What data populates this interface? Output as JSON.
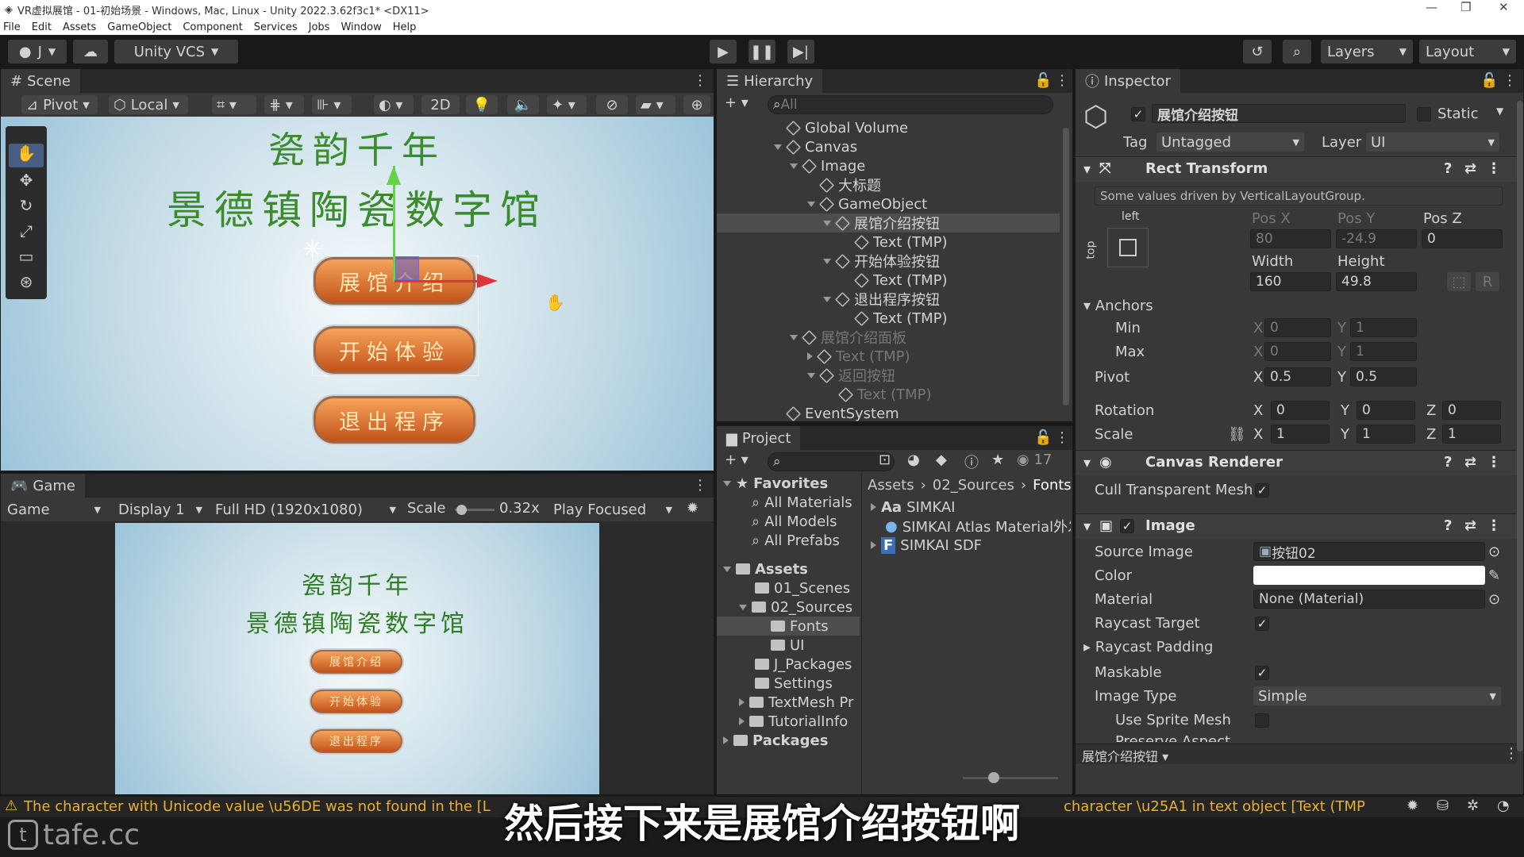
{
  "titlebar": {
    "title": "VR虚拟展馆 - 01-初始场景 - Windows, Mac, Linux - Unity 2022.3.62f3c1* <DX11>"
  },
  "menu": [
    "File",
    "Edit",
    "Assets",
    "GameObject",
    "Component",
    "Services",
    "Jobs",
    "Window",
    "Help"
  ],
  "toolbar": {
    "account": "J",
    "vcs": "Unity VCS",
    "layers": "Layers",
    "layout": "Layout"
  },
  "scene": {
    "tab": "Scene",
    "pivot": "Pivot",
    "local": "Local",
    "mode2d": "2D",
    "title1": "瓷韵千年",
    "title2": "景德镇陶瓷数字馆",
    "buttons": [
      "展馆介绍",
      "开始体验",
      "退出程序"
    ]
  },
  "game": {
    "tab": "Game",
    "mode": "Game",
    "display": "Display 1",
    "resolution": "Full HD (1920x1080)",
    "scale_label": "Scale",
    "scale_value": "0.32x",
    "play": "Play Focused",
    "title1": "瓷韵千年",
    "title2": "景德镇陶瓷数字馆",
    "buttons": [
      "展馆介绍",
      "开始体验",
      "退出程序"
    ]
  },
  "hierarchy": {
    "tab": "Hierarchy",
    "search": "All",
    "items": [
      "Global Volume",
      "Canvas",
      "Image",
      "大标题",
      "GameObject",
      "展馆介绍按钮",
      "Text (TMP)",
      "开始体验按钮",
      "Text (TMP)",
      "退出程序按钮",
      "Text (TMP)",
      "展馆介绍面板",
      "Text (TMP)",
      "返回按钮",
      "Text (TMP)",
      "EventSystem"
    ]
  },
  "project": {
    "tab": "Project",
    "count": "17",
    "tree": [
      "Favorites",
      "All Materials",
      "All Models",
      "All Prefabs",
      "Assets",
      "01_Scenes",
      "02_Sources",
      "Fonts",
      "UI",
      "J_Packages",
      "Settings",
      "TextMesh Pr",
      "TutorialInfo",
      "Packages"
    ],
    "breadcrumb": [
      "Assets",
      "02_Sources",
      "Fonts"
    ],
    "files": [
      "SIMKAI",
      "SIMKAI Atlas Material外发",
      "SIMKAI SDF"
    ],
    "file_prefix": [
      "Aa",
      "",
      "F"
    ]
  },
  "inspector": {
    "tab": "Inspector",
    "name": "展馆介绍按钮",
    "static": "Static",
    "tag_label": "Tag",
    "tag": "Untagged",
    "layer_label": "Layer",
    "layer": "UI",
    "rect": {
      "title": "Rect Transform",
      "note": "Some values driven by VerticalLayoutGroup.",
      "anchor_h": "left",
      "anchor_v": "top",
      "posx_label": "Pos X",
      "posy_label": "Pos Y",
      "posz_label": "Pos Z",
      "posx": "80",
      "posy": "-24.9",
      "posz": "0",
      "width_label": "Width",
      "height_label": "Height",
      "width": "160",
      "height": "49.8",
      "anchors": "Anchors",
      "min": "Min",
      "max": "Max",
      "min_x": "0",
      "min_y": "1",
      "max_x": "0",
      "max_y": "1",
      "pivot": "Pivot",
      "pivot_x": "0.5",
      "pivot_y": "0.5",
      "rotation": "Rotation",
      "rot": [
        "0",
        "0",
        "0"
      ],
      "scale": "Scale",
      "scl": [
        "1",
        "1",
        "1"
      ],
      "r_btn": "R"
    },
    "canvas_renderer": {
      "title": "Canvas Renderer",
      "cull": "Cull Transparent Mesh"
    },
    "image": {
      "title": "Image",
      "source_label": "Source Image",
      "source": "按钮02",
      "color_label": "Color",
      "material_label": "Material",
      "material": "None (Material)",
      "raycast": "Raycast Target",
      "padding": "Raycast Padding",
      "maskable": "Maskable",
      "type_label": "Image Type",
      "type": "Simple",
      "sprite_mesh": "Use Sprite Mesh",
      "preserve": "Preserve Aspect"
    },
    "footer": "展馆介绍按钮"
  },
  "status": {
    "warning_left": "The character with Unicode value \\u56DE was not found in the [L",
    "warning_right": "character \\u25A1 in text object [Text (TMP"
  },
  "subtitle": "然后接下来是展馆介绍按钮啊",
  "watermark": "tafe.cc",
  "axis": {
    "x": "X",
    "y": "Y",
    "z": "Z"
  }
}
